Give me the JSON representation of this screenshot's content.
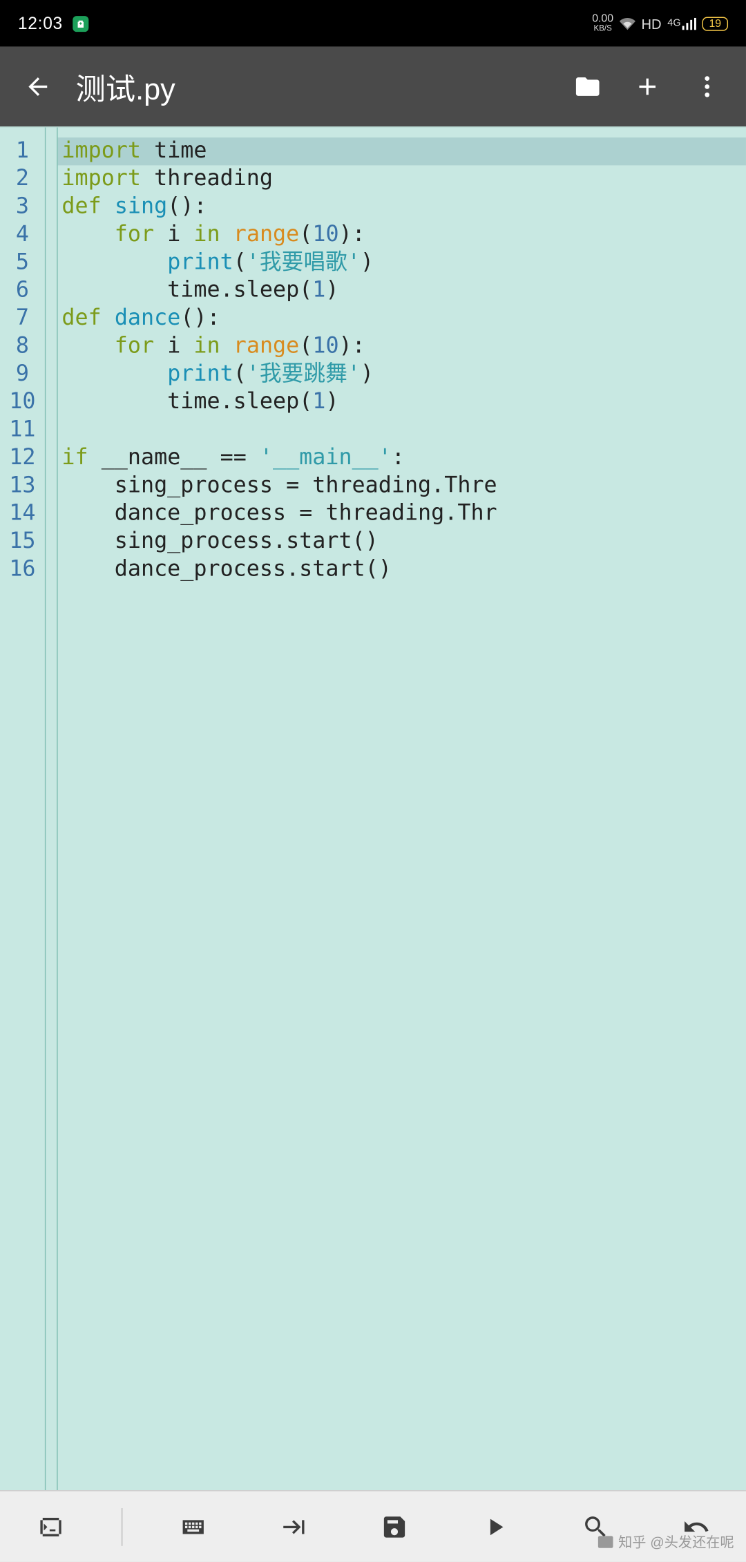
{
  "statusbar": {
    "time": "12:03",
    "net_speed_top": "0.00",
    "net_speed_bot": "KB/S",
    "hd": "HD",
    "sig_label": "4G",
    "battery_pct": "19"
  },
  "appbar": {
    "title": "测试.py"
  },
  "code": {
    "highlight_line": 1,
    "lines": [
      [
        {
          "t": "import",
          "c": "kw"
        },
        {
          "t": " "
        },
        {
          "t": "time"
        }
      ],
      [
        {
          "t": "import",
          "c": "kw"
        },
        {
          "t": " "
        },
        {
          "t": "threading"
        }
      ],
      [
        {
          "t": "def",
          "c": "kw"
        },
        {
          "t": " "
        },
        {
          "t": "sing",
          "c": "fn"
        },
        {
          "t": "():"
        }
      ],
      [
        {
          "t": "    "
        },
        {
          "t": "for",
          "c": "kw"
        },
        {
          "t": " i "
        },
        {
          "t": "in",
          "c": "kw"
        },
        {
          "t": " "
        },
        {
          "t": "range",
          "c": "bi"
        },
        {
          "t": "("
        },
        {
          "t": "10",
          "c": "num"
        },
        {
          "t": "):"
        }
      ],
      [
        {
          "t": "        "
        },
        {
          "t": "print",
          "c": "fn"
        },
        {
          "t": "("
        },
        {
          "t": "'我要唱歌'",
          "c": "str"
        },
        {
          "t": ")"
        }
      ],
      [
        {
          "t": "        time.sleep("
        },
        {
          "t": "1",
          "c": "num"
        },
        {
          "t": ")"
        }
      ],
      [
        {
          "t": "def",
          "c": "kw"
        },
        {
          "t": " "
        },
        {
          "t": "dance",
          "c": "fn"
        },
        {
          "t": "():"
        }
      ],
      [
        {
          "t": "    "
        },
        {
          "t": "for",
          "c": "kw"
        },
        {
          "t": " i "
        },
        {
          "t": "in",
          "c": "kw"
        },
        {
          "t": " "
        },
        {
          "t": "range",
          "c": "bi"
        },
        {
          "t": "("
        },
        {
          "t": "10",
          "c": "num"
        },
        {
          "t": "):"
        }
      ],
      [
        {
          "t": "        "
        },
        {
          "t": "print",
          "c": "fn"
        },
        {
          "t": "("
        },
        {
          "t": "'我要跳舞'",
          "c": "str"
        },
        {
          "t": ")"
        }
      ],
      [
        {
          "t": "        time.sleep("
        },
        {
          "t": "1",
          "c": "num"
        },
        {
          "t": ")"
        }
      ],
      [],
      [
        {
          "t": "if",
          "c": "kw"
        },
        {
          "t": " __name__ == "
        },
        {
          "t": "'__main__'",
          "c": "str"
        },
        {
          "t": ":"
        }
      ],
      [
        {
          "t": "    sing_process = threading.Thre"
        }
      ],
      [
        {
          "t": "    dance_process = threading.Thr"
        }
      ],
      [
        {
          "t": "    sing_process.start()"
        }
      ],
      [
        {
          "t": "    dance_process.start()"
        }
      ]
    ]
  },
  "watermark": {
    "site": "知乎",
    "user": "@头发还在呢"
  }
}
